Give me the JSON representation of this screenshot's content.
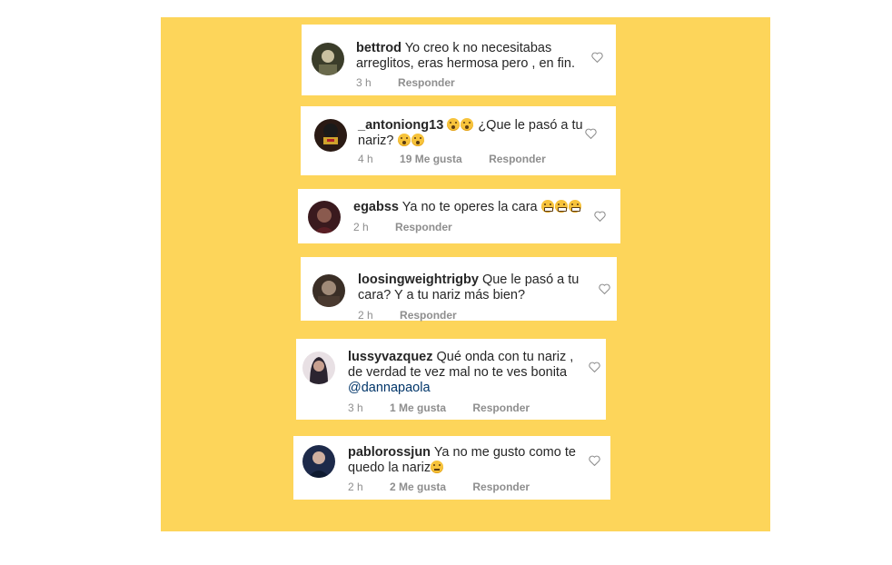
{
  "comments": [
    {
      "username": "bettrod",
      "text_line1": "Yo creo k no necesitabas",
      "text_line2": "arreglitos, eras hermosa pero , en fin.",
      "time": "3 h",
      "reply": "Responder",
      "avatar_color": "#3b3d2a"
    },
    {
      "username": "_antoniong13",
      "text_line1": "¿Que le pasó a tu",
      "text_line2": "nariz?",
      "emojis_line1": [
        "hushed-face-emoji",
        "hushed-face-emoji"
      ],
      "emojis_line2": [
        "hushed-face-emoji",
        "hushed-face-emoji"
      ],
      "time": "4 h",
      "likes": "19 Me gusta",
      "reply": "Responder",
      "avatar_color": "#2a1a14"
    },
    {
      "username": "egabss",
      "text_line1": "Ya no te operes la cara",
      "emojis_line1": [
        "grimacing-face-emoji",
        "grimacing-face-emoji",
        "grimacing-face-emoji"
      ],
      "time": "2 h",
      "reply": "Responder",
      "avatar_color": "#3a1a1e"
    },
    {
      "username": "loosingweightrigby",
      "text_line1": "Que le pasó a tu",
      "text_line2": "cara? Y a tu nariz más bien?",
      "time": "2 h",
      "reply": "Responder",
      "avatar_color": "#3a2e26"
    },
    {
      "username": "lussyvazquez",
      "text_line1": "Qué onda con tu nariz ,",
      "text_line2": "de verdad te vez mal no te ves bonita",
      "mention": "@dannapaola",
      "time": "3 h",
      "likes": "1 Me gusta",
      "reply": "Responder",
      "avatar_color": "#2b2430"
    },
    {
      "username": "pablorossjun",
      "text_line1": "Ya no me gusto como te",
      "text_line2": "quedo la nariz",
      "emojis_line2": [
        "neutral-face-emoji"
      ],
      "time": "2 h",
      "likes": "2 Me gusta",
      "reply": "Responder",
      "avatar_color": "#1d2a4a"
    }
  ],
  "colors": {
    "background": "#fdd55a",
    "card": "#ffffff",
    "text": "#262626",
    "meta": "#8e8e8e",
    "mention": "#003569"
  }
}
